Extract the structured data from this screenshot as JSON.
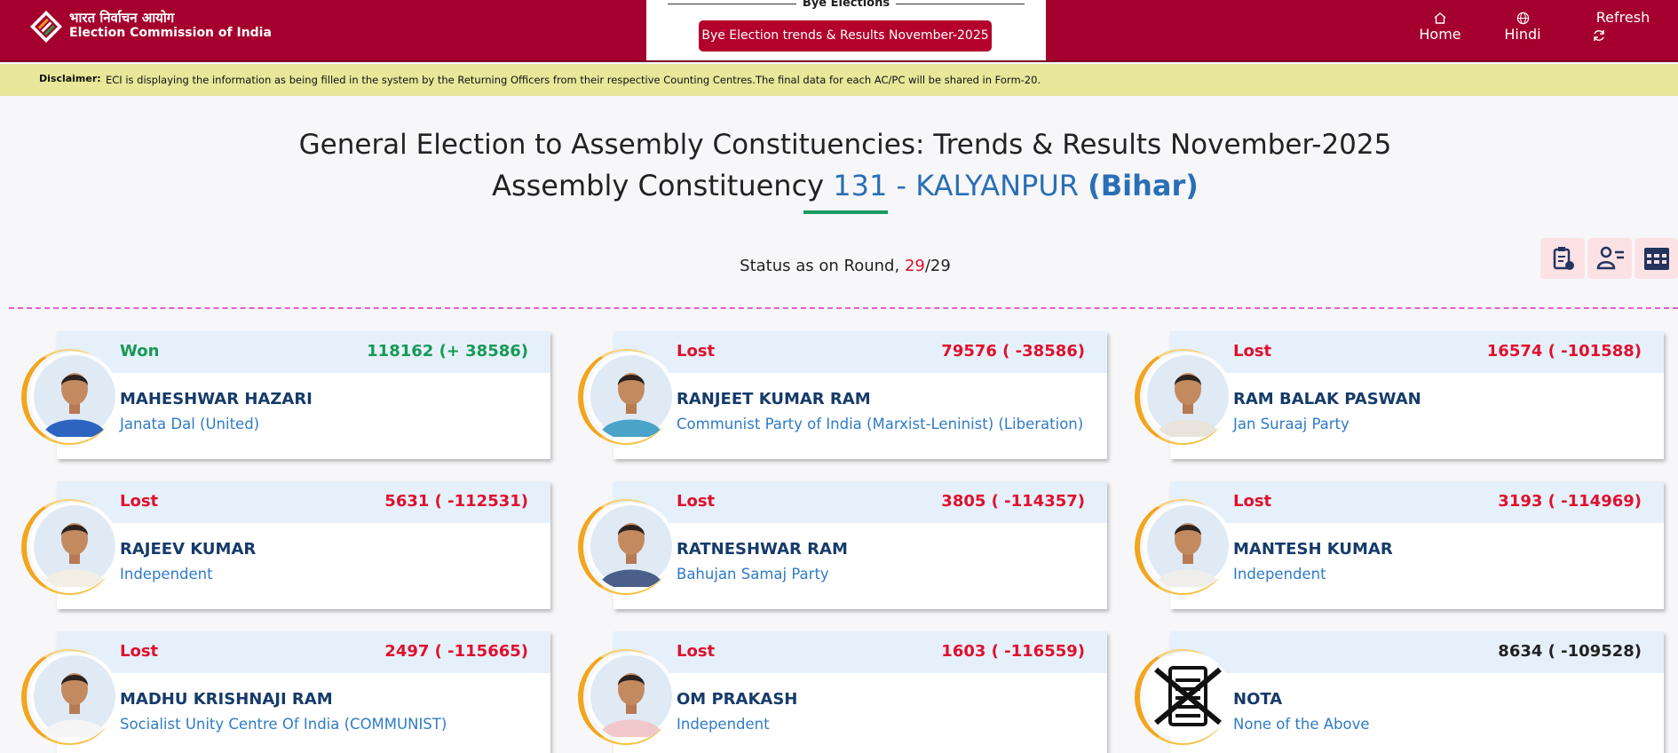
{
  "header": {
    "brand_hindi": "भारत निर्वाचन आयोग",
    "brand_english": "Election Commission of India",
    "bye_title": "Bye Elections",
    "bye_button": "Bye Election trends & Results November-2025",
    "nav_home": "Home",
    "nav_hindi": "Hindi",
    "nav_refresh": "Refresh"
  },
  "disclaimer": {
    "label": "Disclaimer:",
    "text": "ECI is displaying the information as being filled in the system by the Returning Officers from their respective Counting Centres.The final data for each AC/PC will be shared in Form-20."
  },
  "page": {
    "title_line1": "General Election to Assembly Constituencies: Trends & Results November-2025",
    "title_line2_prefix": "Assembly Constituency",
    "constituency": "131 - KALYANPUR",
    "state": "(Bihar)",
    "status_prefix": "Status as on Round,",
    "round_current": "29",
    "round_total": "/29"
  },
  "candidates": [
    {
      "result": "Won",
      "votes": "118162 (+ 38586)",
      "name": "MAHESHWAR HAZARI",
      "party": "Janata Dal (United)",
      "status": "won",
      "shirt": "#2c64c0"
    },
    {
      "result": "Lost",
      "votes": "79576 ( -38586)",
      "name": "RANJEET KUMAR RAM",
      "party": "Communist Party of India (Marxist-Leninist) (Liberation)",
      "status": "lost",
      "shirt": "#4aa3c9"
    },
    {
      "result": "Lost",
      "votes": "16574 ( -101588)",
      "name": "RAM BALAK PASWAN",
      "party": "Jan Suraaj Party",
      "status": "lost",
      "shirt": "#e8e4dc"
    },
    {
      "result": "Lost",
      "votes": "5631 ( -112531)",
      "name": "RAJEEV KUMAR",
      "party": "Independent",
      "status": "lost",
      "shirt": "#f2eee4"
    },
    {
      "result": "Lost",
      "votes": "3805 ( -114357)",
      "name": "RATNESHWAR RAM",
      "party": "Bahujan Samaj Party",
      "status": "lost",
      "shirt": "#4a5f8a"
    },
    {
      "result": "Lost",
      "votes": "3193 ( -114969)",
      "name": "MANTESH KUMAR",
      "party": "Independent",
      "status": "lost",
      "shirt": "#f0eeea"
    },
    {
      "result": "Lost",
      "votes": "2497 ( -115665)",
      "name": "MADHU KRISHNAJI RAM",
      "party": "Socialist Unity Centre Of India (COMMUNIST)",
      "status": "lost",
      "shirt": "#f5f5f5"
    },
    {
      "result": "Lost",
      "votes": "1603 ( -116559)",
      "name": "OM PRAKASH",
      "party": "Independent",
      "status": "lost",
      "shirt": "#f1c7c9"
    },
    {
      "result": "",
      "votes": "8634 ( -109528)",
      "name": "NOTA",
      "party": "None of the Above",
      "status": "neutral",
      "shirt": "nota"
    }
  ],
  "colors": {
    "header_bg": "#a5002d",
    "disclaimer_bg": "#e8e79a",
    "won": "#179a55",
    "lost": "#e0102c",
    "accent_blue": "#2a6fb5",
    "dashed_divider": "#e55bd1"
  },
  "icons": {
    "logo": "eci-logo-icon",
    "home": "home-icon",
    "hindi": "globe-icon",
    "refresh": "refresh-icon",
    "tool_1": "report-icon",
    "tool_2": "candidate-list-icon",
    "tool_3": "table-icon"
  }
}
